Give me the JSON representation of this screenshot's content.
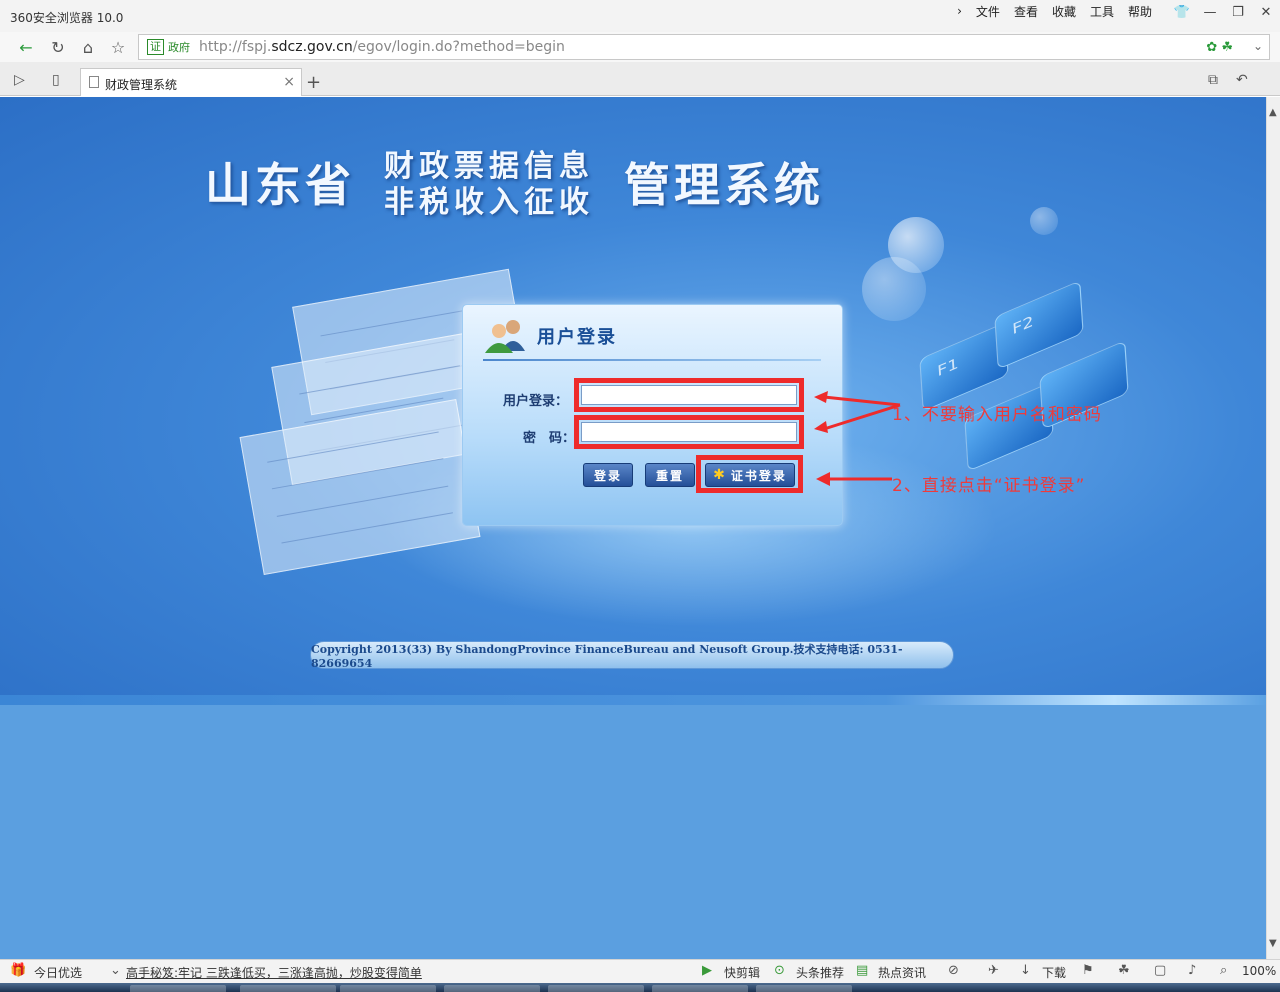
{
  "browser": {
    "title": "360安全浏览器 10.0",
    "menu": [
      "文件",
      "查看",
      "收藏",
      "工具",
      "帮助"
    ],
    "cert_badge": "证",
    "cert_label": "政府",
    "url_prefix": "http://fspj.",
    "url_domain": "sdcz.gov.cn",
    "url_path": "/egov/login.do?method=begin",
    "tab_title": "财政管理系统",
    "zoom": "100%"
  },
  "page": {
    "title_left": "山东省",
    "title_line1": "财政票据信息",
    "title_line2": "非税收入征收",
    "title_right": "管理系统",
    "login_title": "用户登录",
    "username_label": "用户登录：",
    "password_label": "密　码：",
    "username_value": "",
    "password_value": "",
    "btn_login": "登录",
    "btn_reset": "重置",
    "btn_cert": "证书登录",
    "copyright": "Copyright 2013(33) By ShandongProvince FinanceBureau and Neusoft Group.技术支持电话: 0531-82669654"
  },
  "annotations": {
    "note1": "1、不要输入用户名和密码",
    "note2": "2、直接点击“证书登录”",
    "color": "#ee2b2b"
  },
  "statusbar": {
    "today": "今日优选",
    "news": "高手秘笈:牢记 三跌逢低买，三涨逢高抛，炒股变得简单",
    "quick_edit": "快剪辑",
    "headline": "头条推荐",
    "hot": "热点资讯",
    "download": "下载"
  }
}
